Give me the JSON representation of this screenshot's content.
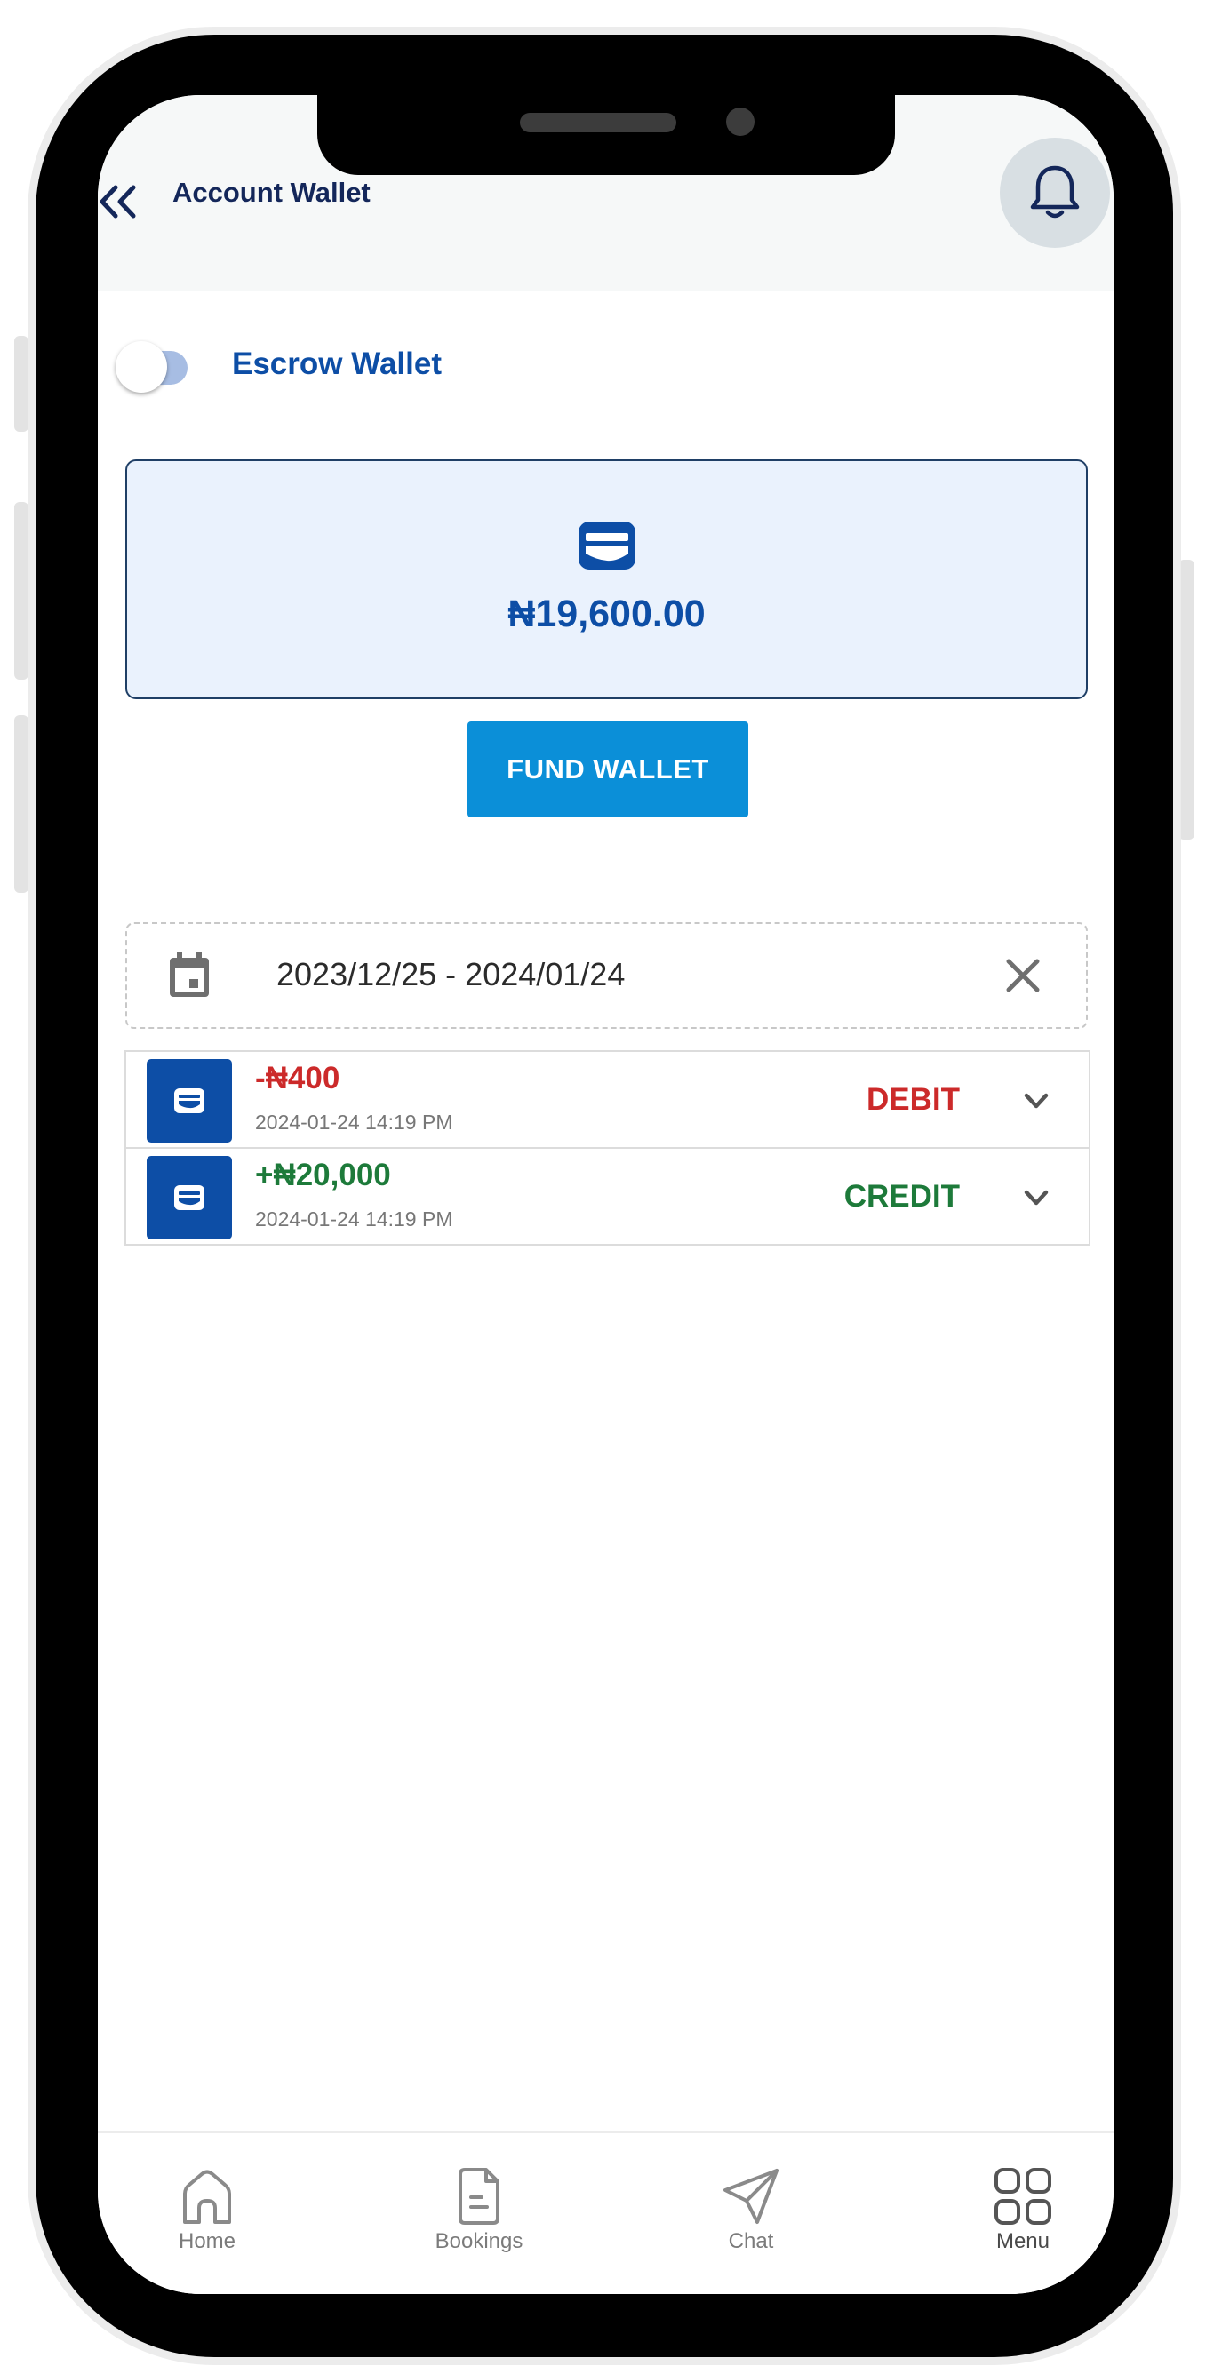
{
  "header": {
    "title": "Account Wallet",
    "back_icon": "double-chevron-left-icon",
    "bell_icon": "bell-icon"
  },
  "escrow": {
    "label": "Escrow Wallet",
    "toggle_on": false
  },
  "balance": {
    "amount": "₦19,600.00",
    "icon": "wallet-icon"
  },
  "fund_wallet": {
    "label": "FUND WALLET"
  },
  "date_filter": {
    "value": "2023/12/25 - 2024/01/24",
    "icon": "calendar-icon",
    "clear_icon": "close-icon"
  },
  "transactions": [
    {
      "amount": "-₦400",
      "date": "2024-01-24 14:19 PM",
      "type": "DEBIT"
    },
    {
      "amount": "+₦20,000",
      "date": "2024-01-24 14:19 PM",
      "type": "CREDIT"
    }
  ],
  "bottom_nav": {
    "items": [
      {
        "label": "Home",
        "icon": "home-icon"
      },
      {
        "label": "Bookings",
        "icon": "document-icon"
      },
      {
        "label": "Chat",
        "icon": "send-icon"
      },
      {
        "label": "Menu",
        "icon": "grid-icon"
      }
    ]
  },
  "colors": {
    "primary": "#0d4ea6",
    "navy": "#14275a",
    "fund_button": "#0b8fd8",
    "debit": "#cc2a2a",
    "credit": "#1d7a3a",
    "card_bg": "#eaf2fd"
  }
}
